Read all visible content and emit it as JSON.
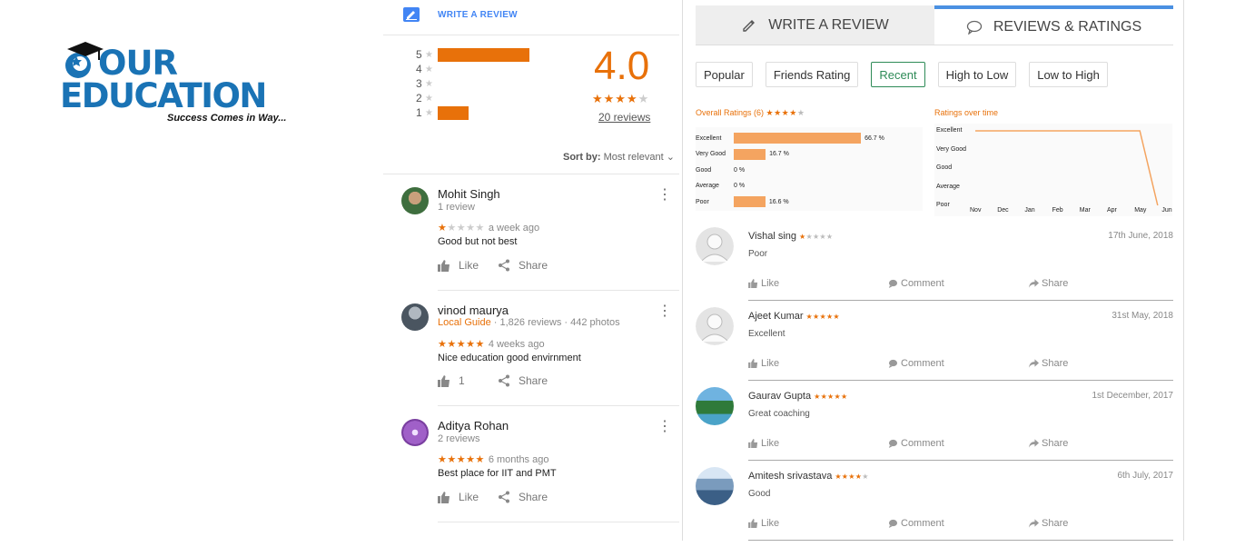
{
  "logo": {
    "line1": "OUR",
    "line2": "EDUCATION",
    "tagline": "Success Comes in Way..."
  },
  "google": {
    "write_review": "WRITE A REVIEW",
    "histogram": [
      {
        "label": "5",
        "fraction": 0.5
      },
      {
        "label": "4",
        "fraction": 0
      },
      {
        "label": "3",
        "fraction": 0
      },
      {
        "label": "2",
        "fraction": 0
      },
      {
        "label": "1",
        "fraction": 0.17
      }
    ],
    "rating": "4.0",
    "rating_stars": 4,
    "review_count": "20 reviews",
    "sort_prefix": "Sort by:",
    "sort_value": "Most relevant",
    "reviews": [
      {
        "name": "Mohit Singh",
        "sub": "1 review",
        "guide": "",
        "stars": 1,
        "when": "a week ago",
        "text": "Good but not best",
        "like_label": "Like",
        "share_label": "Share"
      },
      {
        "name": "vinod maurya",
        "sub": "· 1,826 reviews · 442 photos",
        "guide": "Local Guide",
        "stars": 5,
        "when": "4 weeks ago",
        "text": "Nice education good envirnment",
        "like_label": "1",
        "share_label": "Share"
      },
      {
        "name": "Aditya Rohan",
        "sub": "2 reviews",
        "guide": "",
        "stars": 5,
        "when": "6 months ago",
        "text": "Best place for IIT and PMT",
        "like_label": "Like",
        "share_label": "Share"
      }
    ]
  },
  "site": {
    "tabs": {
      "write": "WRITE A REVIEW",
      "reviews": "REVIEWS & RATINGS"
    },
    "filters": [
      "Popular",
      "Friends Rating",
      "Recent",
      "High to Low",
      "Low to High"
    ],
    "active_filter": "Recent",
    "overall_title": "Overall Ratings (6)",
    "overall_stars": 4,
    "time_title": "Ratings over time",
    "actions": {
      "like": "Like",
      "comment": "Comment",
      "share": "Share"
    },
    "reviews": [
      {
        "name": "Vishal sing",
        "stars": 1,
        "date": "17th June, 2018",
        "text": "Poor",
        "avatar": "placeholder"
      },
      {
        "name": "Ajeet Kumar",
        "stars": 5,
        "date": "31st May, 2018",
        "text": "Excellent",
        "avatar": "placeholder"
      },
      {
        "name": "Gaurav Gupta",
        "stars": 5,
        "date": "1st December, 2017",
        "text": "Great coaching",
        "avatar": "landscape"
      },
      {
        "name": "Amitesh srivastava",
        "stars": 3.5,
        "date": "6th July, 2017",
        "text": "Good",
        "avatar": "mountain"
      }
    ]
  },
  "chart_data": [
    {
      "type": "bar",
      "title": "Overall Ratings (6)",
      "categories": [
        "Excellent",
        "Very Good",
        "Good",
        "Average",
        "Poor"
      ],
      "values": [
        66.7,
        16.7,
        0,
        0,
        16.6
      ],
      "labels": [
        "66.7 %",
        "16.7 %",
        "0 %",
        "0 %",
        "16.6 %"
      ],
      "orientation": "horizontal"
    },
    {
      "type": "line",
      "title": "Ratings over time",
      "categories": [
        "Excellent",
        "Very Good",
        "Good",
        "Average",
        "Poor"
      ],
      "x": [
        "Nov",
        "Dec",
        "Jan",
        "Feb",
        "Mar",
        "Apr",
        "May",
        "Jun"
      ],
      "values": [
        "Excellent",
        "Excellent",
        "Excellent",
        "Excellent",
        "Excellent",
        "Excellent",
        "Excellent",
        "Poor"
      ]
    }
  ]
}
